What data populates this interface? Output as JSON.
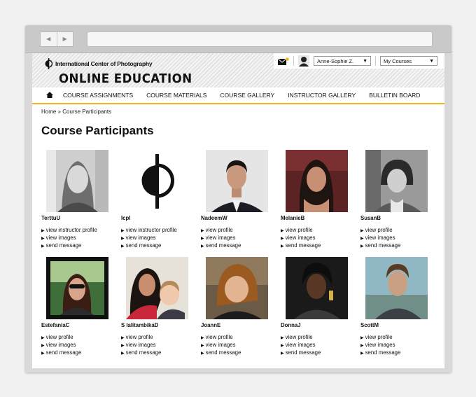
{
  "browser": {
    "back_label": "◀",
    "forward_label": "▶"
  },
  "site": {
    "org_name": "International Center of Photography",
    "title": "ONLINE EDUCATION",
    "logo_icon": "icp-logo-icon",
    "accent_color": "#f4b520"
  },
  "userbar": {
    "mail_icon": "envelope-icon",
    "user_name": "Anne-Sophie Z.",
    "courses_label": "My Courses"
  },
  "nav": {
    "home_icon": "home-icon",
    "items": [
      "COURSE ASSIGNMENTS",
      "COURSE MATERIALS",
      "COURSE GALLERY",
      "INSTRUCTOR GALLERY",
      "BULLETIN BOARD"
    ]
  },
  "breadcrumb": "Home » Course Participants",
  "page_title": "Course Participants",
  "participants": [
    {
      "name": "TerttuU",
      "links": [
        "view instructor profile",
        "view images",
        "send message"
      ]
    },
    {
      "name": "IcpI",
      "links": [
        "view instructor profile",
        "view images",
        "send message"
      ]
    },
    {
      "name": "NadeemW",
      "links": [
        "view profile",
        "view images",
        "send message"
      ]
    },
    {
      "name": "MelanieB",
      "links": [
        "view profile",
        "view images",
        "send message"
      ]
    },
    {
      "name": "SusanB",
      "links": [
        "view profile",
        "view images",
        "send message"
      ]
    },
    {
      "name": "EstefaniaC",
      "links": [
        "view profile",
        "view images",
        "send message"
      ]
    },
    {
      "name": "S lalitambikaD",
      "links": [
        "view profile",
        "view images",
        "send message"
      ]
    },
    {
      "name": "JoannE",
      "links": [
        "view profile",
        "view images",
        "send message"
      ]
    },
    {
      "name": "DonnaJ",
      "links": [
        "view profile",
        "view images",
        "send message"
      ]
    },
    {
      "name": "ScottM",
      "links": [
        "view profile",
        "view images",
        "send message"
      ]
    }
  ]
}
